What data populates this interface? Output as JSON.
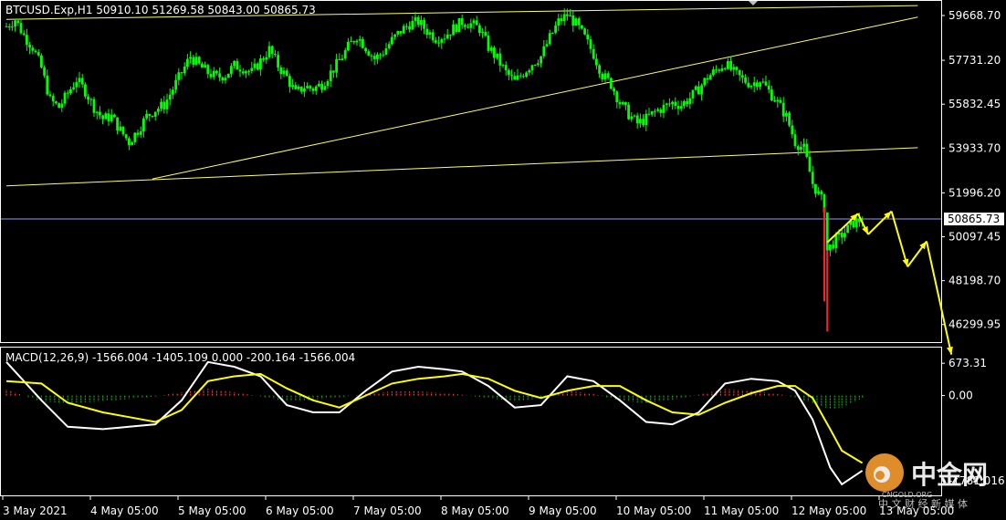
{
  "symbol_header": "BTCUSD.Exp,H1  50910.10 51269.58 50843.00 50865.73",
  "macd_header": "MACD(12,26,9) -1566.004 -1405.109 0.000 -200.164 -1566.004",
  "colors": {
    "background": "#000000",
    "bull": "#00ff00",
    "bear": "#00ff00",
    "wick": "#00ff00",
    "spike": "#ff2020",
    "trendline": "#ffff66",
    "arrows": "#ffff00",
    "hist_pos": "#ff3030",
    "hist_neg": "#00b000",
    "macd_line": "#ffffff",
    "signal_line": "#ffff00",
    "bid_line": "#8c9bff",
    "frame": "#ffffff"
  },
  "chart_data": [
    {
      "type": "candlestick",
      "title": "BTCUSD.Exp,H1",
      "y_ticks": [
        "59668.70",
        "57731.20",
        "55832.45",
        "53933.70",
        "51996.20",
        "50097.45",
        "48198.70",
        "46299.95"
      ],
      "ylim": [
        45500,
        60300
      ],
      "current_price": "50865.73",
      "x_ticks": [
        "3 May 2021",
        "4 May 05:00",
        "5 May 05:00",
        "6 May 05:00",
        "7 May 05:00",
        "8 May 05:00",
        "9 May 05:00",
        "10 May 05:00",
        "11 May 05:00",
        "12 May 05:00",
        "13 May 05:00"
      ],
      "close_path": [
        [
          0,
          59200
        ],
        [
          6,
          59500
        ],
        [
          12,
          58800
        ],
        [
          18,
          58300
        ],
        [
          24,
          57400
        ],
        [
          30,
          56000
        ],
        [
          36,
          55700
        ],
        [
          42,
          56300
        ],
        [
          48,
          56900
        ],
        [
          54,
          56400
        ],
        [
          60,
          55700
        ],
        [
          66,
          55200
        ],
        [
          72,
          55300
        ],
        [
          78,
          54700
        ],
        [
          84,
          54200
        ],
        [
          90,
          54700
        ],
        [
          96,
          55300
        ],
        [
          102,
          55600
        ],
        [
          108,
          55800
        ],
        [
          114,
          56500
        ],
        [
          120,
          57200
        ],
        [
          126,
          57900
        ],
        [
          132,
          57500
        ],
        [
          138,
          57200
        ],
        [
          144,
          57000
        ],
        [
          150,
          57100
        ],
        [
          156,
          57500
        ],
        [
          162,
          57400
        ],
        [
          168,
          57200
        ],
        [
          174,
          57700
        ],
        [
          180,
          58200
        ],
        [
          186,
          57500
        ],
        [
          192,
          57000
        ],
        [
          198,
          56300
        ],
        [
          204,
          56600
        ],
        [
          210,
          56500
        ],
        [
          216,
          56700
        ],
        [
          222,
          57200
        ],
        [
          228,
          57700
        ],
        [
          234,
          58300
        ],
        [
          240,
          58800
        ],
        [
          246,
          58300
        ],
        [
          252,
          57800
        ],
        [
          258,
          58100
        ],
        [
          264,
          58600
        ],
        [
          270,
          59000
        ],
        [
          276,
          59300
        ],
        [
          282,
          59400
        ],
        [
          288,
          59000
        ],
        [
          294,
          58700
        ],
        [
          300,
          58800
        ],
        [
          306,
          59100
        ],
        [
          312,
          59400
        ],
        [
          318,
          59300
        ],
        [
          324,
          59100
        ],
        [
          330,
          58300
        ],
        [
          336,
          57800
        ],
        [
          342,
          57200
        ],
        [
          348,
          56800
        ],
        [
          354,
          57200
        ],
        [
          360,
          57600
        ],
        [
          366,
          57900
        ],
        [
          372,
          58700
        ],
        [
          378,
          59400
        ],
        [
          384,
          59700
        ],
        [
          390,
          59300
        ],
        [
          396,
          58700
        ],
        [
          402,
          58000
        ],
        [
          408,
          57100
        ],
        [
          414,
          56700
        ],
        [
          420,
          55900
        ],
        [
          426,
          55400
        ],
        [
          432,
          55000
        ],
        [
          438,
          55200
        ],
        [
          444,
          55500
        ],
        [
          450,
          55700
        ],
        [
          456,
          55900
        ],
        [
          462,
          55800
        ],
        [
          468,
          56100
        ],
        [
          474,
          56500
        ],
        [
          480,
          57000
        ],
        [
          486,
          57300
        ],
        [
          492,
          57600
        ],
        [
          498,
          57200
        ],
        [
          504,
          56900
        ],
        [
          510,
          56700
        ],
        [
          516,
          56900
        ],
        [
          522,
          56400
        ],
        [
          528,
          55900
        ],
        [
          534,
          55300
        ],
        [
          540,
          54200
        ],
        [
          546,
          53900
        ],
        [
          552,
          52400
        ],
        [
          558,
          51700
        ],
        [
          561,
          51200
        ],
        [
          562,
          49500
        ],
        [
          567,
          49900
        ],
        [
          574,
          50300
        ],
        [
          580,
          50700
        ],
        [
          586,
          50866
        ]
      ],
      "spikes": [
        [
          560,
          47300
        ],
        [
          562,
          46000
        ]
      ],
      "trendlines": [
        {
          "p1": [
            0,
            59500
          ],
          "p2": [
            624,
            60100
          ]
        },
        {
          "p1": [
            0,
            52300
          ],
          "p2": [
            624,
            53950
          ]
        },
        {
          "p1": [
            100,
            52600
          ],
          "p2": [
            624,
            59600
          ]
        }
      ],
      "forecast_arrows": [
        [
          562,
          49850
        ],
        [
          583,
          51100
        ],
        [
          590,
          50200
        ],
        [
          606,
          51200
        ],
        [
          617,
          48800
        ],
        [
          630,
          49900
        ],
        [
          647,
          45000
        ]
      ]
    },
    {
      "type": "macd",
      "title": "MACD(12,26,9)",
      "y_ticks": [
        "673.31",
        "0.00",
        "-1781.016"
      ],
      "ylim": [
        -2100,
        1000
      ],
      "series": [
        {
          "name": "MACD",
          "values": [
            [
              0,
              700
            ],
            [
              24,
              -100
            ],
            [
              42,
              -650
            ],
            [
              66,
              -700
            ],
            [
              84,
              -650
            ],
            [
              102,
              -600
            ],
            [
              120,
              -100
            ],
            [
              138,
              700
            ],
            [
              156,
              600
            ],
            [
              174,
              400
            ],
            [
              192,
              -200
            ],
            [
              210,
              -350
            ],
            [
              228,
              -350
            ],
            [
              246,
              100
            ],
            [
              264,
              500
            ],
            [
              282,
              600
            ],
            [
              300,
              550
            ],
            [
              312,
              500
            ],
            [
              330,
              200
            ],
            [
              348,
              -250
            ],
            [
              366,
              -200
            ],
            [
              384,
              400
            ],
            [
              402,
              300
            ],
            [
              420,
              -100
            ],
            [
              438,
              -550
            ],
            [
              456,
              -600
            ],
            [
              474,
              -350
            ],
            [
              492,
              250
            ],
            [
              510,
              350
            ],
            [
              528,
              300
            ],
            [
              540,
              100
            ],
            [
              552,
              -500
            ],
            [
              564,
              -1500
            ],
            [
              572,
              -1850
            ],
            [
              586,
              -1566
            ]
          ]
        },
        {
          "name": "Signal",
          "values": [
            [
              0,
              300
            ],
            [
              24,
              250
            ],
            [
              42,
              -150
            ],
            [
              66,
              -350
            ],
            [
              84,
              -450
            ],
            [
              102,
              -550
            ],
            [
              120,
              -300
            ],
            [
              138,
              300
            ],
            [
              156,
              400
            ],
            [
              174,
              450
            ],
            [
              192,
              150
            ],
            [
              210,
              -100
            ],
            [
              228,
              -250
            ],
            [
              246,
              0
            ],
            [
              264,
              250
            ],
            [
              282,
              350
            ],
            [
              300,
              400
            ],
            [
              312,
              450
            ],
            [
              330,
              350
            ],
            [
              348,
              100
            ],
            [
              366,
              -50
            ],
            [
              384,
              100
            ],
            [
              402,
              200
            ],
            [
              420,
              200
            ],
            [
              438,
              -100
            ],
            [
              456,
              -350
            ],
            [
              474,
              -400
            ],
            [
              492,
              -150
            ],
            [
              510,
              50
            ],
            [
              528,
              200
            ],
            [
              540,
              200
            ],
            [
              552,
              -50
            ],
            [
              564,
              -700
            ],
            [
              572,
              -1150
            ],
            [
              586,
              -1405
            ]
          ]
        }
      ],
      "histogram": [
        [
          0,
          350
        ],
        [
          24,
          -350
        ],
        [
          42,
          -450
        ],
        [
          66,
          -350
        ],
        [
          84,
          -200
        ],
        [
          102,
          -50
        ],
        [
          120,
          200
        ],
        [
          138,
          400
        ],
        [
          156,
          200
        ],
        [
          174,
          -50
        ],
        [
          192,
          -350
        ],
        [
          210,
          -250
        ],
        [
          228,
          -100
        ],
        [
          246,
          100
        ],
        [
          264,
          250
        ],
        [
          282,
          250
        ],
        [
          300,
          150
        ],
        [
          312,
          50
        ],
        [
          330,
          -150
        ],
        [
          348,
          -350
        ],
        [
          366,
          -150
        ],
        [
          384,
          300
        ],
        [
          402,
          100
        ],
        [
          420,
          -300
        ],
        [
          438,
          -450
        ],
        [
          456,
          -250
        ],
        [
          474,
          50
        ],
        [
          492,
          400
        ],
        [
          510,
          300
        ],
        [
          528,
          100
        ],
        [
          540,
          -100
        ],
        [
          552,
          -450
        ],
        [
          564,
          -800
        ],
        [
          572,
          -700
        ],
        [
          586,
          -160
        ]
      ]
    }
  ]
}
